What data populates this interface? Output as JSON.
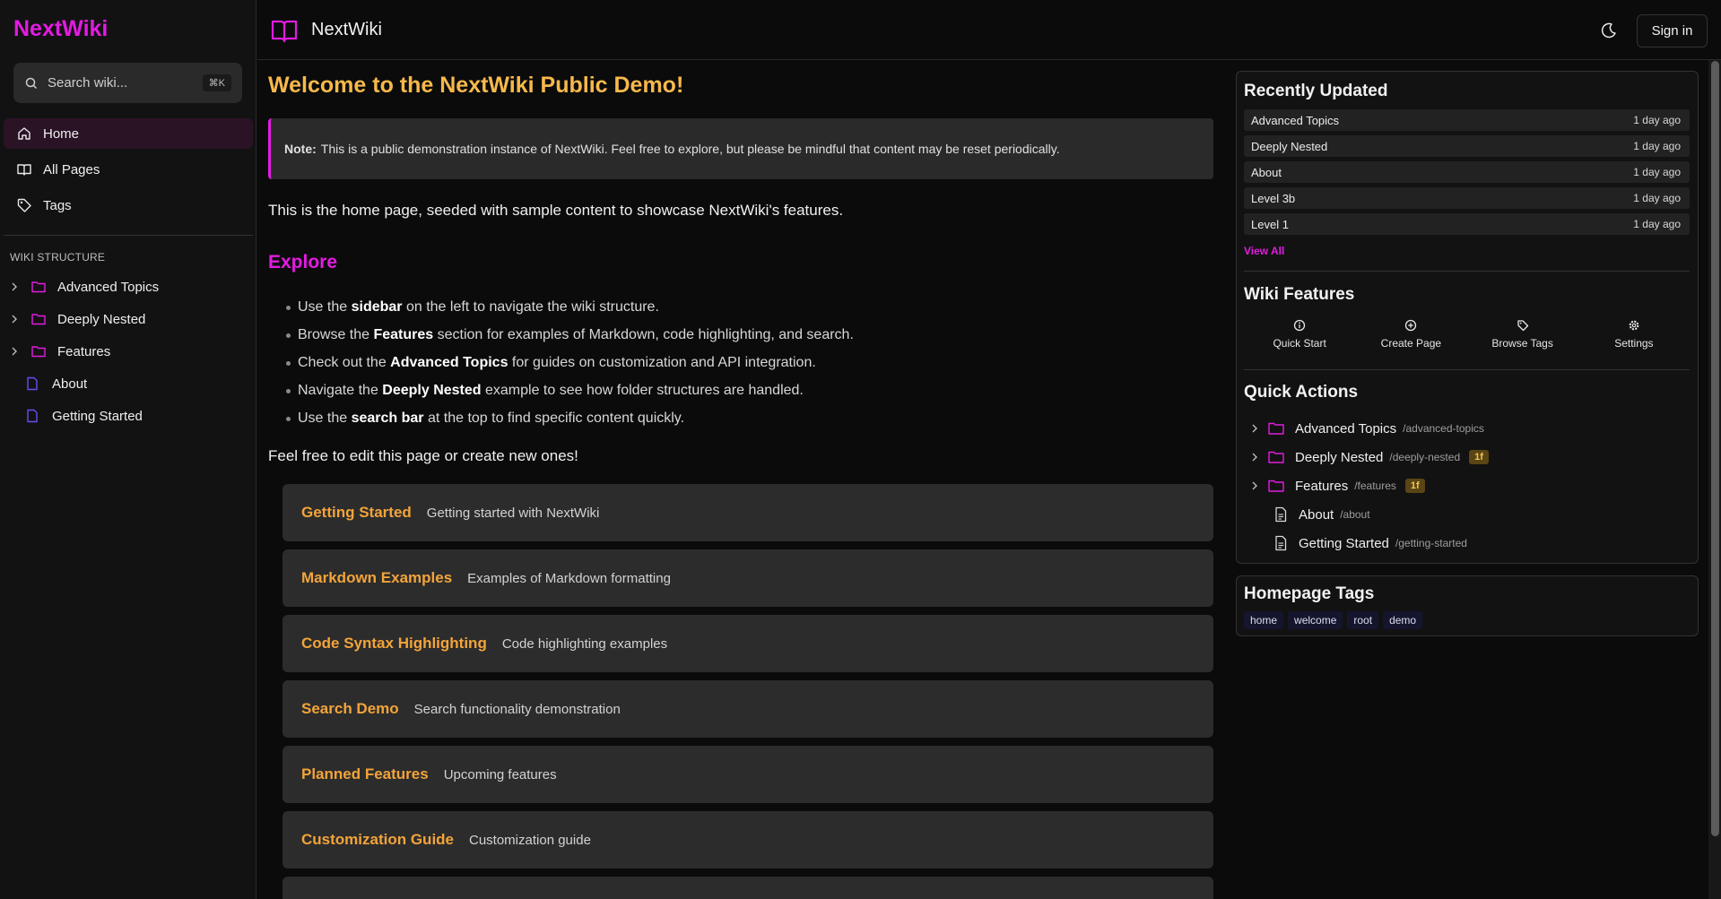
{
  "sidebar": {
    "brand": "NextWiki",
    "search": {
      "placeholder": "Search wiki...",
      "shortcut": "⌘K"
    },
    "nav": [
      {
        "label": "Home",
        "icon": "home-icon",
        "active": true
      },
      {
        "label": "All Pages",
        "icon": "book-icon"
      },
      {
        "label": "Tags",
        "icon": "tag-icon"
      }
    ],
    "structure_title": "WIKI STRUCTURE",
    "tree": [
      {
        "label": "Advanced Topics",
        "type": "folder"
      },
      {
        "label": "Deeply Nested",
        "type": "folder"
      },
      {
        "label": "Features",
        "type": "folder"
      },
      {
        "label": "About",
        "type": "file"
      },
      {
        "label": "Getting Started",
        "type": "file"
      }
    ]
  },
  "header": {
    "title": "NextWiki",
    "signin": "Sign in"
  },
  "main": {
    "title": "Welcome to the NextWiki Public Demo!",
    "note_label": "Note:",
    "note_text": "This is a public demonstration instance of NextWiki. Feel free to explore, but please be mindful that content may be reset periodically.",
    "intro": "This is the home page, seeded with sample content to showcase NextWiki's features.",
    "explore_heading": "Explore",
    "bullets": [
      {
        "pre": "Use the ",
        "bold": "sidebar",
        "post": " on the left to navigate the wiki structure."
      },
      {
        "pre": "Browse the ",
        "bold": "Features",
        "post": " section for examples of Markdown, code highlighting, and search."
      },
      {
        "pre": "Check out the ",
        "bold": "Advanced Topics",
        "post": " for guides on customization and API integration."
      },
      {
        "pre": "Navigate the ",
        "bold": "Deeply Nested",
        "post": " example to see how folder structures are handled."
      },
      {
        "pre": "Use the ",
        "bold": "search bar",
        "post": " at the top to find specific content quickly."
      }
    ],
    "outro": "Feel free to edit this page or create new ones!",
    "cards": [
      {
        "title": "Getting Started",
        "desc": "Getting started with NextWiki"
      },
      {
        "title": "Markdown Examples",
        "desc": "Examples of Markdown formatting"
      },
      {
        "title": "Code Syntax Highlighting",
        "desc": "Code highlighting examples"
      },
      {
        "title": "Search Demo",
        "desc": "Search functionality demonstration"
      },
      {
        "title": "Planned Features",
        "desc": "Upcoming features"
      },
      {
        "title": "Customization Guide",
        "desc": "Customization guide"
      },
      {
        "title": "",
        "desc": ""
      }
    ]
  },
  "recent": {
    "title": "Recently Updated",
    "items": [
      {
        "name": "Advanced Topics",
        "time": "1 day ago"
      },
      {
        "name": "Deeply Nested",
        "time": "1 day ago"
      },
      {
        "name": "About",
        "time": "1 day ago"
      },
      {
        "name": "Level 3b",
        "time": "1 day ago"
      },
      {
        "name": "Level 1",
        "time": "1 day ago"
      }
    ],
    "view_all": "View All"
  },
  "features": {
    "title": "Wiki Features",
    "items": [
      {
        "label": "Quick Start",
        "icon": "info-circle-icon"
      },
      {
        "label": "Create Page",
        "icon": "plus-circle-icon"
      },
      {
        "label": "Browse Tags",
        "icon": "tag-icon"
      },
      {
        "label": "Settings",
        "icon": "gear-icon"
      }
    ]
  },
  "quick_actions": {
    "title": "Quick Actions",
    "items": [
      {
        "label": "Advanced Topics",
        "slug": "/advanced-topics",
        "type": "folder",
        "badge": ""
      },
      {
        "label": "Deeply Nested",
        "slug": "/deeply-nested",
        "type": "folder",
        "badge": "1f"
      },
      {
        "label": "Features",
        "slug": "/features",
        "type": "folder",
        "badge": "1f"
      },
      {
        "label": "About",
        "slug": "/about",
        "type": "file",
        "badge": ""
      },
      {
        "label": "Getting Started",
        "slug": "/getting-started",
        "type": "file",
        "badge": ""
      }
    ]
  },
  "homepage_tags": {
    "title": "Homepage Tags",
    "tags": [
      "home",
      "welcome",
      "root",
      "demo"
    ]
  },
  "colors": {
    "accent": "#e21ce0",
    "heading": "#f7b94b",
    "card_title": "#f3a43a",
    "background": "#0b0b0b"
  }
}
